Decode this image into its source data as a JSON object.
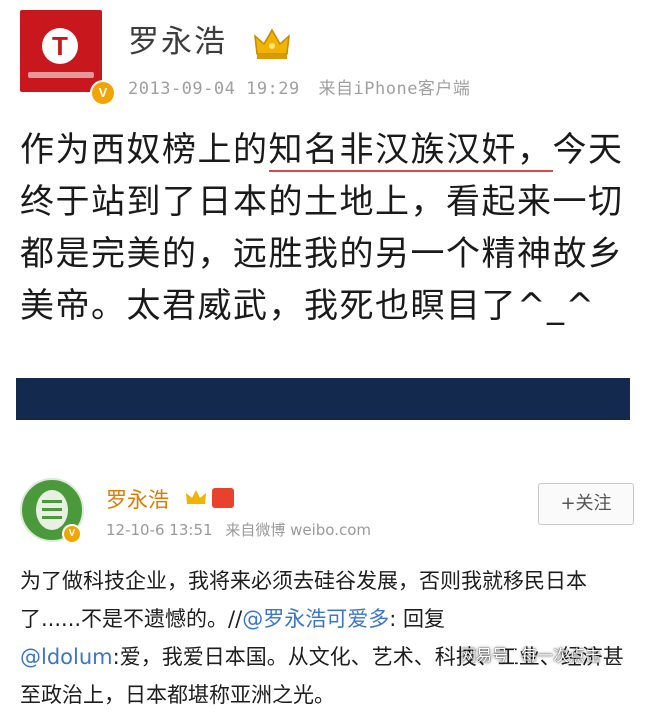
{
  "post1": {
    "avatar_letter": "T",
    "username": "罗永浩",
    "timestamp": "2013-09-04 19:29",
    "source": "来自iPhone客户端",
    "text_before": "作为西奴榜上的",
    "text_underlined": "知名非汉族汉奸，",
    "text_after": "今天终于站到了日本的土地上，看起来一切都是完美的，远胜我的另一个精神故乡美帝。太君威武，我死也瞑目了^_^"
  },
  "post2": {
    "username": "罗永浩",
    "timestamp": "12-10-6 13:51",
    "source": "来自微博 weibo.com",
    "follow_label": "+关注",
    "text_start": "为了做科技企业，我将来必须去硅谷发展，否则我就移民日本了......不是不遗憾的。//",
    "mention1": "@罗永浩可爱多",
    "text_mid": ": 回复",
    "mention2": "@ldolum",
    "text_end": ":爱，我爱日本国。从文化、艺术、科技、工业、经济甚至政治上，日本都堪称亚洲之光。"
  },
  "watermark": {
    "brand": "网易号",
    "tagline": "每一次点击"
  },
  "colors": {
    "avatar_red": "#c9171e",
    "verified_badge": "#f2a400",
    "name_orange": "#e07b00",
    "link_blue": "#3b77c7",
    "divider_navy": "#13294d"
  }
}
